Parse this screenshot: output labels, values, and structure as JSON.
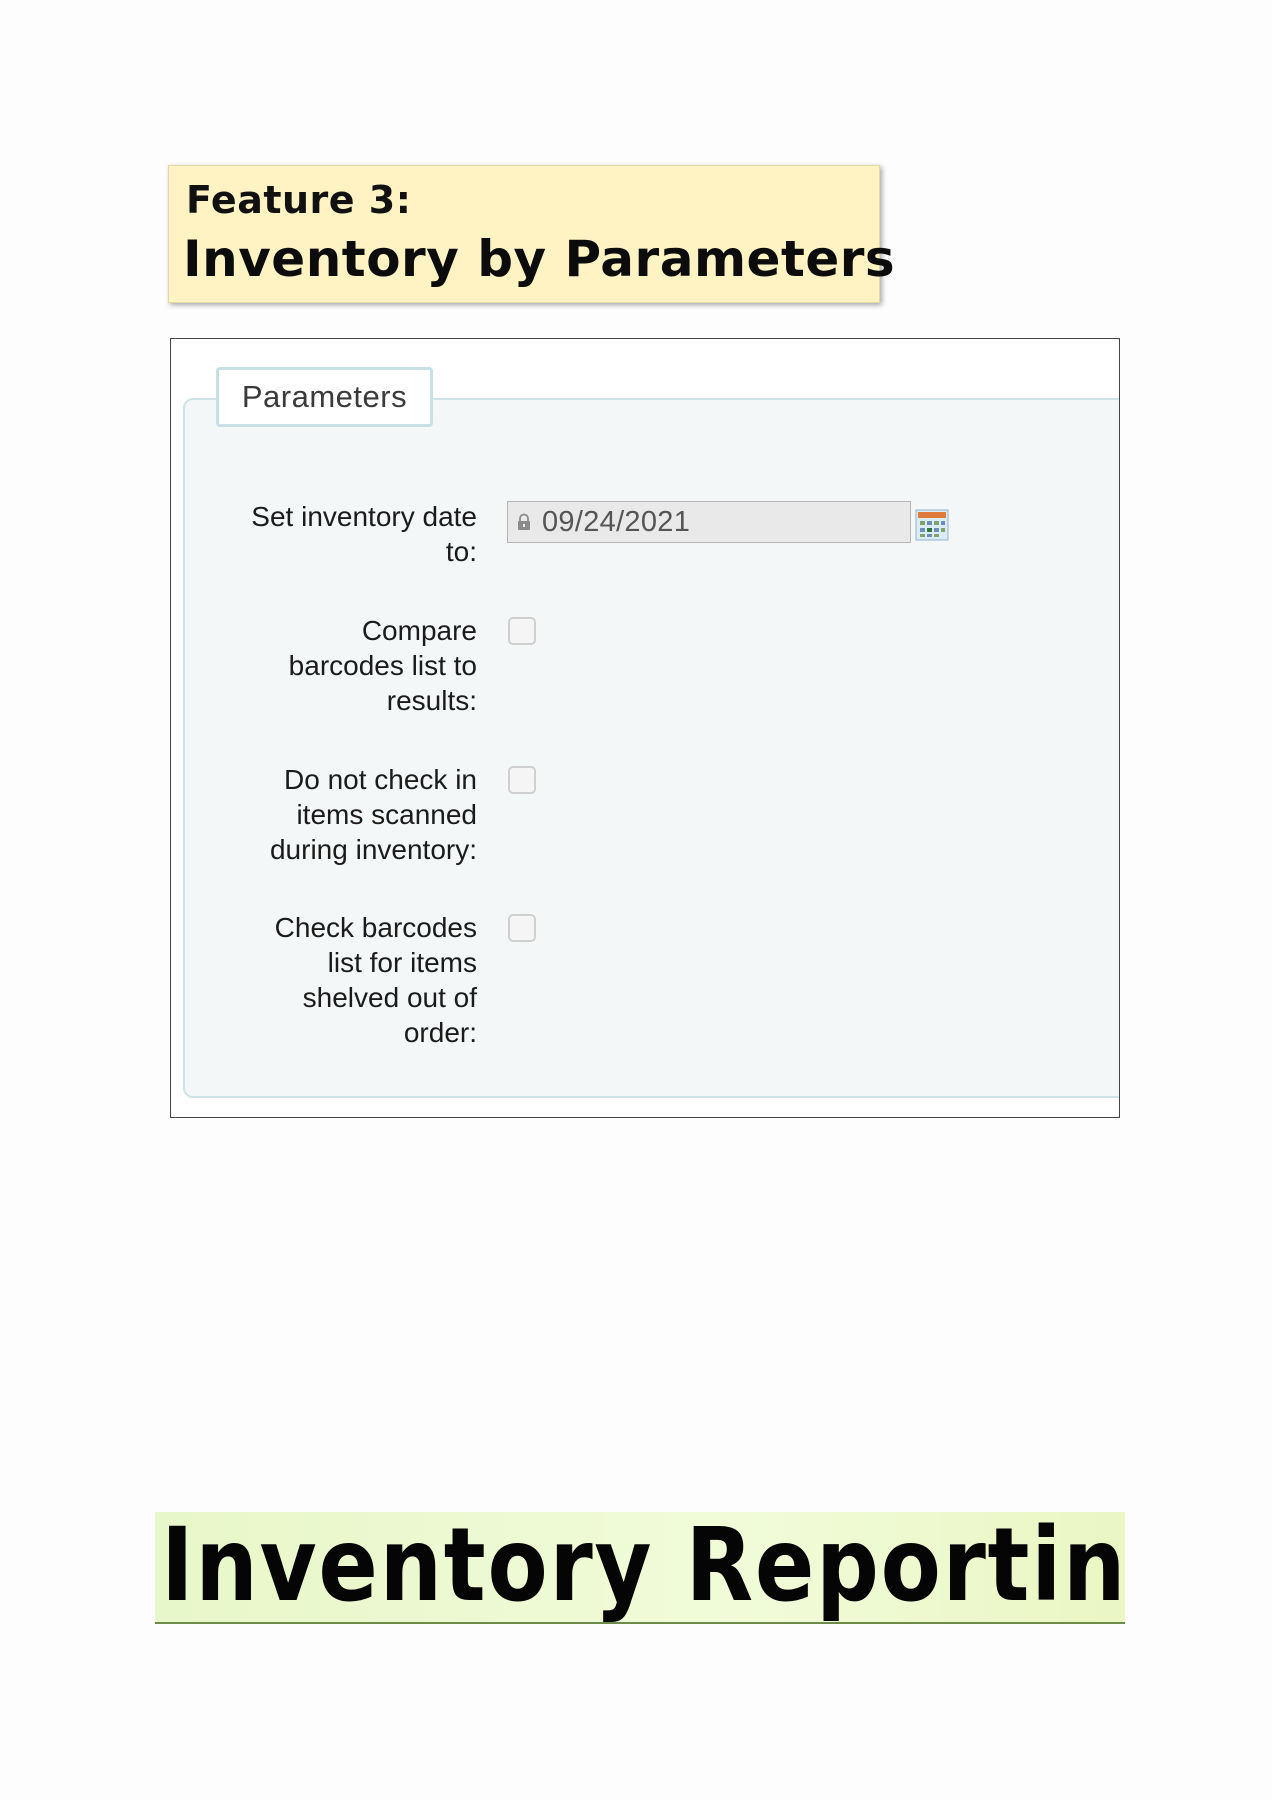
{
  "feature_banner": {
    "label": "Feature 3:",
    "title": "Inventory by Parameters",
    "background_color": "#fff3c4"
  },
  "parameters_form": {
    "legend": "Parameters",
    "fields": [
      {
        "label_lines": [
          "Set inventory date",
          "to:"
        ],
        "type": "date",
        "value": "09/24/2021",
        "locked": true,
        "icons": [
          "lock-icon",
          "calendar-icon"
        ]
      },
      {
        "label_lines": [
          "Compare",
          "barcodes list to",
          "results:"
        ],
        "type": "checkbox",
        "checked": false
      },
      {
        "label_lines": [
          "Do not check in",
          "items scanned",
          "during inventory:"
        ],
        "type": "checkbox",
        "checked": false
      },
      {
        "label_lines": [
          "Check barcodes",
          "list for items",
          "shelved out of",
          "order:"
        ],
        "type": "checkbox",
        "checked": false
      }
    ]
  },
  "report_heading": {
    "text": "Inventory Reporting",
    "background_color": "#eaf7c9"
  }
}
